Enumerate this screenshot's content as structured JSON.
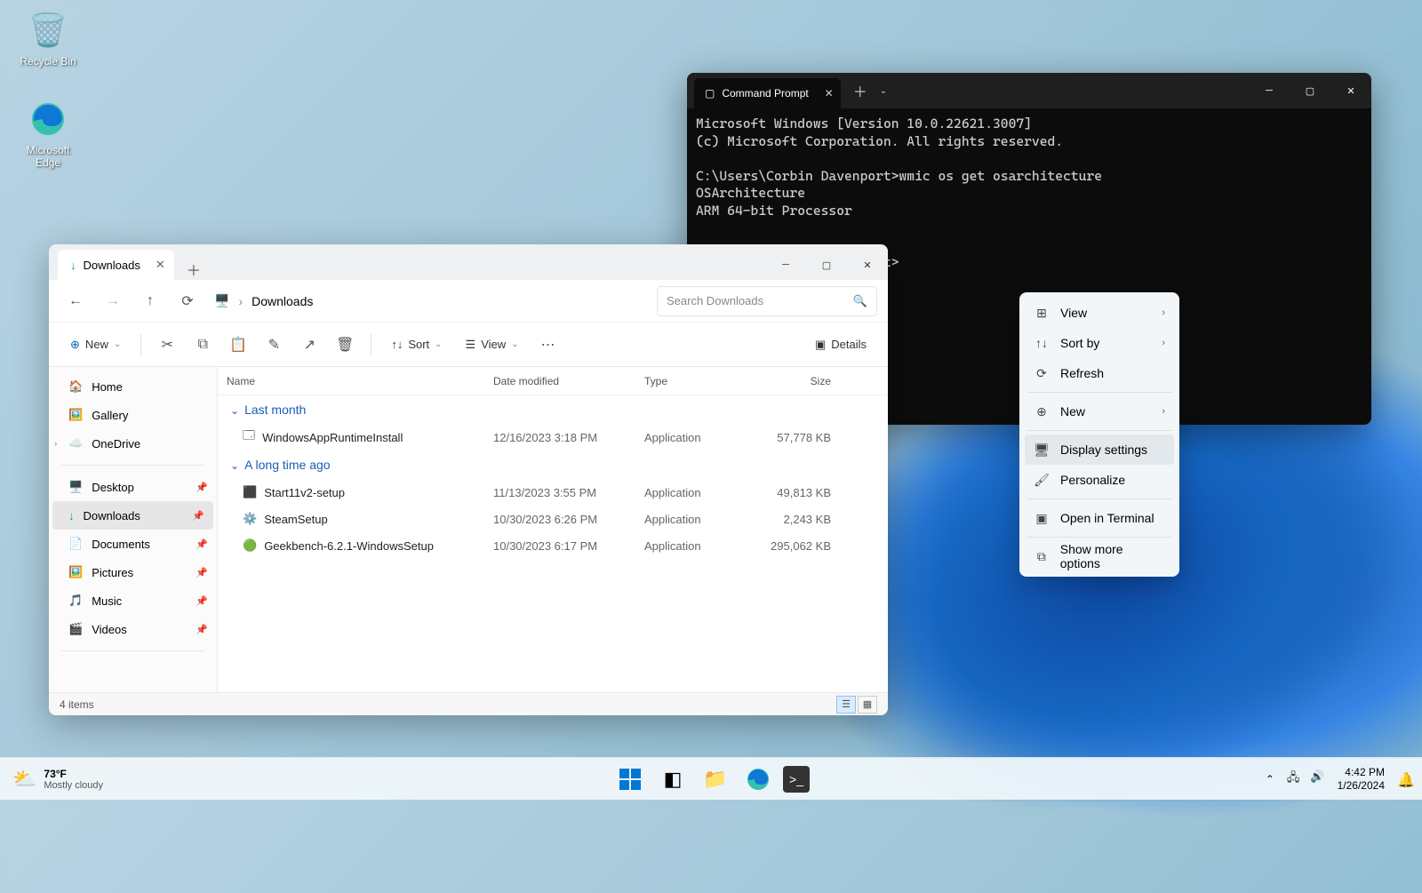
{
  "desktop": {
    "recycle_bin": "Recycle Bin",
    "edge": "Microsoft Edge"
  },
  "terminal": {
    "tab_title": "Command Prompt",
    "lines": [
      "Microsoft Windows [Version 10.0.22621.3007]",
      "(c) Microsoft Corporation. All rights reserved.",
      "",
      "C:\\Users\\Corbin Davenport>wmic os get osarchitecture",
      "OSArchitecture",
      "ARM 64-bit Processor",
      "",
      "",
      "C:\\Users\\Corbin Davenport>"
    ]
  },
  "explorer": {
    "tab_title": "Downloads",
    "breadcrumb": "Downloads",
    "search_placeholder": "Search Downloads",
    "toolbar": {
      "new": "New",
      "sort": "Sort",
      "view": "View",
      "details": "Details"
    },
    "side": {
      "home": "Home",
      "gallery": "Gallery",
      "onedrive": "OneDrive",
      "desktop": "Desktop",
      "downloads": "Downloads",
      "documents": "Documents",
      "pictures": "Pictures",
      "music": "Music",
      "videos": "Videos"
    },
    "cols": {
      "name": "Name",
      "date": "Date modified",
      "type": "Type",
      "size": "Size"
    },
    "groups": {
      "last_month": "Last month",
      "long_ago": "A long time ago"
    },
    "rows": [
      {
        "name": "WindowsAppRuntimeInstall",
        "date": "12/16/2023 3:18 PM",
        "type": "Application",
        "size": "57,778 KB"
      },
      {
        "name": "Start11v2-setup",
        "date": "11/13/2023 3:55 PM",
        "type": "Application",
        "size": "49,813 KB"
      },
      {
        "name": "SteamSetup",
        "date": "10/30/2023 6:26 PM",
        "type": "Application",
        "size": "2,243 KB"
      },
      {
        "name": "Geekbench-6.2.1-WindowsSetup",
        "date": "10/30/2023 6:17 PM",
        "type": "Application",
        "size": "295,062 KB"
      }
    ],
    "status": "4 items"
  },
  "ctx": {
    "view": "View",
    "sort": "Sort by",
    "refresh": "Refresh",
    "new": "New",
    "display": "Display settings",
    "personalize": "Personalize",
    "terminal": "Open in Terminal",
    "more": "Show more options"
  },
  "taskbar": {
    "temp": "73°F",
    "cond": "Mostly cloudy",
    "time": "4:42 PM",
    "date": "1/26/2024"
  }
}
